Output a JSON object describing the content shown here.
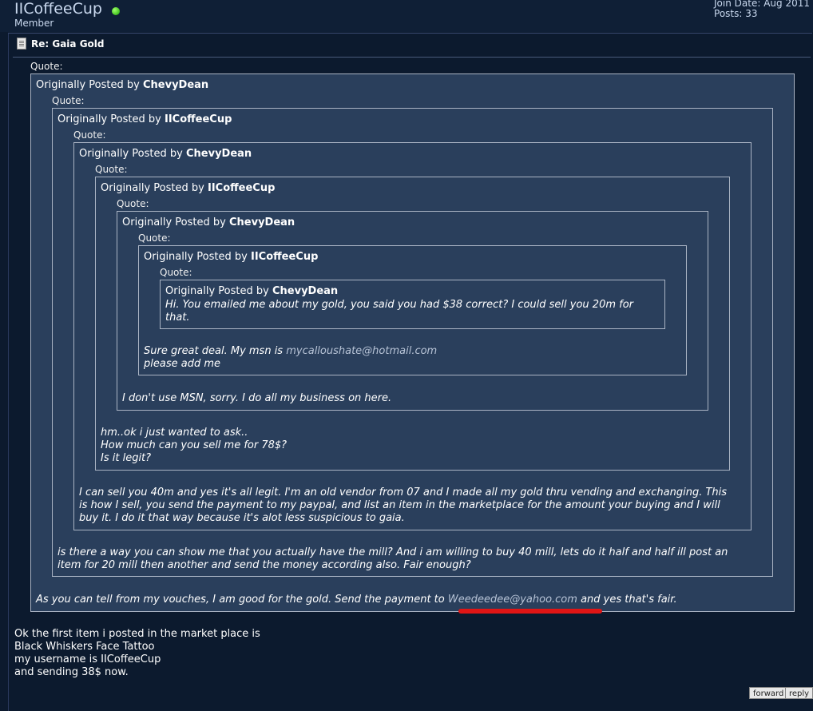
{
  "user": {
    "name": "IICoffeeCup",
    "title": "Member",
    "join_label": "Join Date:",
    "join_value": "Aug 2011",
    "posts_label": "Posts:",
    "posts_value": "33"
  },
  "post": {
    "title": "Re: Gaia Gold",
    "quote_label": "Quote:",
    "posted_by_prefix": "Originally Posted by",
    "quotes": [
      {
        "author": "ChevyDean",
        "lines": [
          "As you can tell from my vouches, I am good for the gold. Send the payment to ",
          "Weedeedee@yahoo.com",
          " and yes that's fair."
        ]
      },
      {
        "author": "IICoffeeCup",
        "lines": [
          "is there a way you can show me that you actually have the mill? And i am willing to buy 40 mill, lets do it half and half ill post an",
          "item for 20 mill then another and send the money according also. Fair enough?"
        ]
      },
      {
        "author": "ChevyDean",
        "lines": [
          "I can sell you 40m and yes it's all legit. I'm an old vendor from 07 and I made all my gold thru vending and exchanging. This",
          "is how I sell, you send the payment to my paypal, and list an item in the marketplace for the amount your buying and I will",
          "buy it. I do it that way because it's alot less suspicious to gaia."
        ]
      },
      {
        "author": "IICoffeeCup",
        "lines": [
          "hm..ok i just wanted to ask..",
          "How much can you sell me for 78$?",
          "Is it legit?"
        ]
      },
      {
        "author": "ChevyDean",
        "lines": [
          "I don't use MSN, sorry. I do all my business on here."
        ]
      },
      {
        "author": "IICoffeeCup",
        "lines": [
          "Sure great deal. My msn is ",
          "mycalloushate@hotmail.com",
          "please add me"
        ]
      },
      {
        "author": "ChevyDean",
        "lines": [
          "Hi. You emailed me about my gold, you said you had $38 correct? I could sell you 20m for",
          "that."
        ]
      }
    ],
    "body_lines": [
      "Ok the first item i posted in the market place is",
      "Black Whiskers Face Tattoo",
      "my username is IICoffeeCup",
      "and sending 38$ now."
    ]
  },
  "buttons": {
    "forward": "forward",
    "reply": "reply"
  },
  "colors": {
    "page_bg": "#0c1a2e",
    "quote_bg": "#2a3f5c",
    "quote_border": "#aab4c4",
    "online_dot": "#1ea800",
    "annotation_red": "#e01515"
  }
}
